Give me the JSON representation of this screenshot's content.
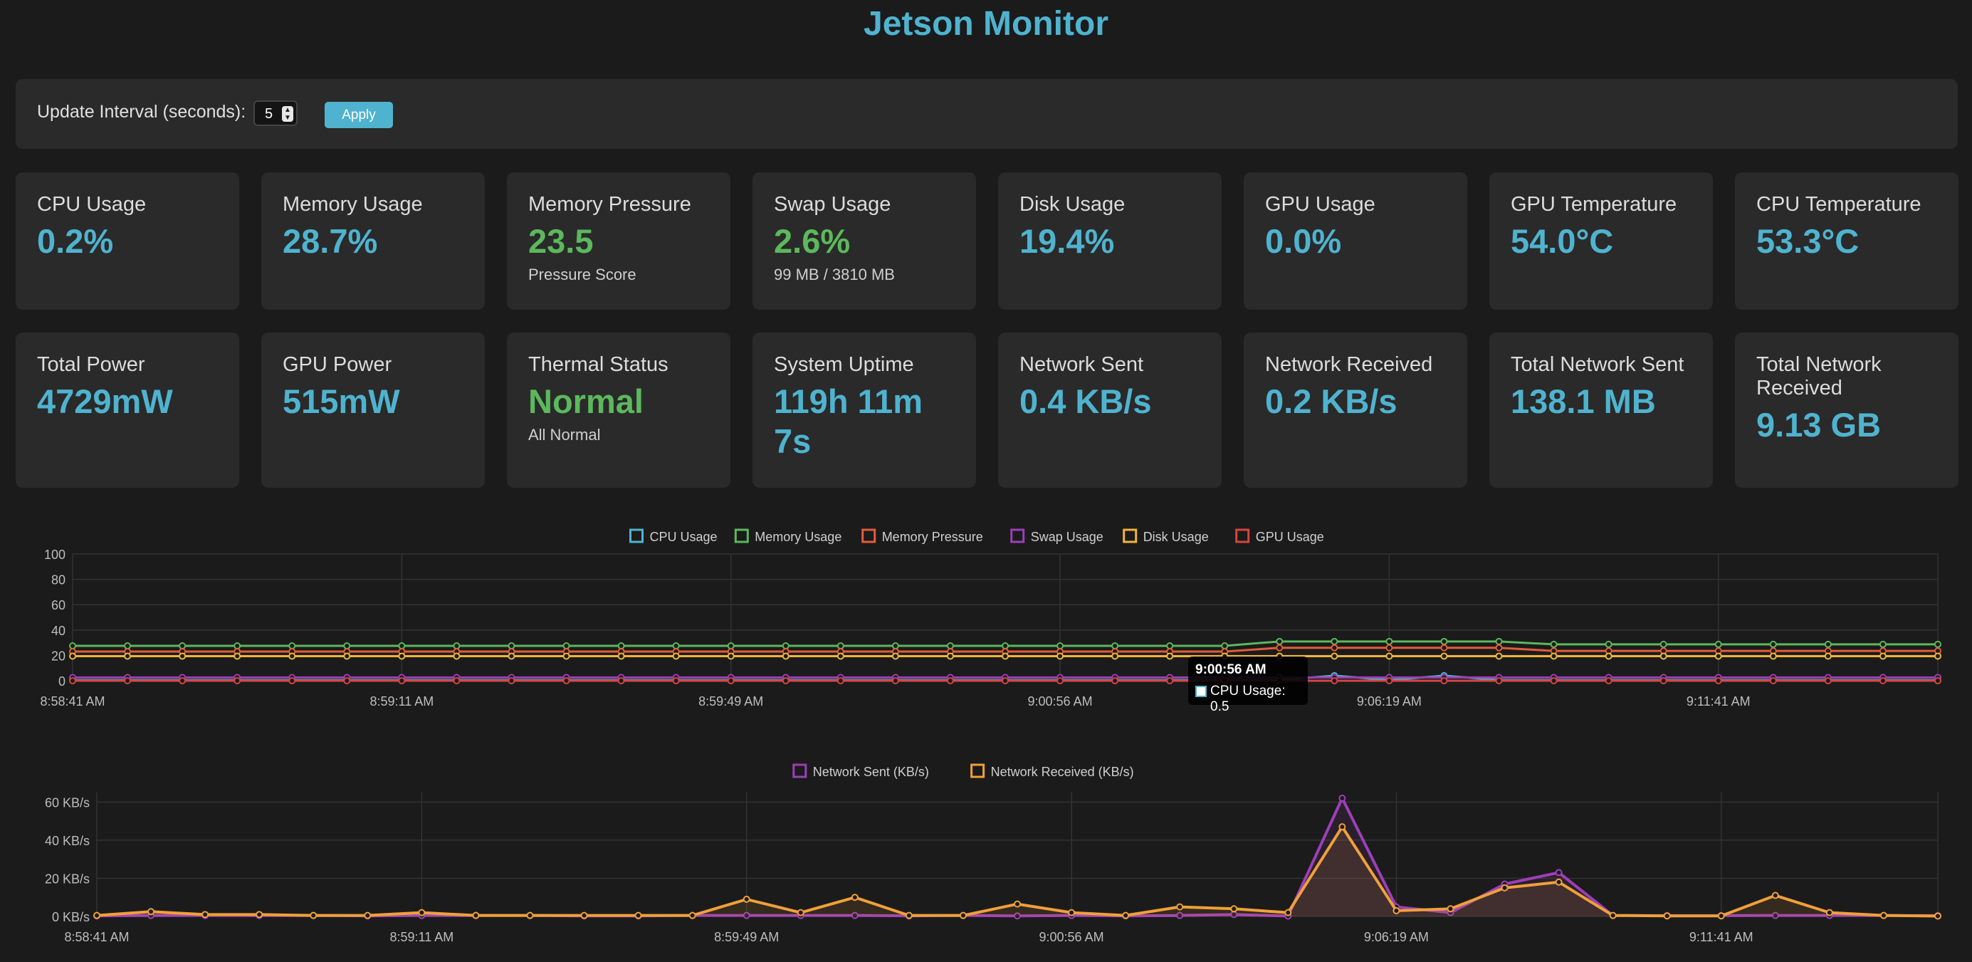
{
  "app": {
    "title": "Jetson Monitor"
  },
  "controls": {
    "interval_label": "Update Interval (seconds):",
    "interval_value": "5",
    "apply_label": "Apply"
  },
  "cards_row1": [
    {
      "title": "CPU Usage",
      "value": "0.2%",
      "sub": "",
      "color": "blue"
    },
    {
      "title": "Memory Usage",
      "value": "28.7%",
      "sub": "",
      "color": "blue"
    },
    {
      "title": "Memory Pressure",
      "value": "23.5",
      "sub": "Pressure Score",
      "color": "green"
    },
    {
      "title": "Swap Usage",
      "value": "2.6%",
      "sub": "99 MB / 3810 MB",
      "color": "green"
    },
    {
      "title": "Disk Usage",
      "value": "19.4%",
      "sub": "",
      "color": "blue"
    },
    {
      "title": "GPU Usage",
      "value": "0.0%",
      "sub": "",
      "color": "blue"
    },
    {
      "title": "GPU Temperature",
      "value": "54.0°C",
      "sub": "",
      "color": "blue"
    },
    {
      "title": "CPU Temperature",
      "value": "53.3°C",
      "sub": "",
      "color": "blue"
    }
  ],
  "cards_row2": [
    {
      "title": "Total Power",
      "value": "4729mW",
      "sub": "",
      "color": "blue"
    },
    {
      "title": "GPU Power",
      "value": "515mW",
      "sub": "",
      "color": "blue"
    },
    {
      "title": "Thermal Status",
      "value": "Normal",
      "sub": "All Normal",
      "color": "green"
    },
    {
      "title": "System Uptime",
      "value": "119h 11m 7s",
      "sub": "",
      "color": "blue"
    },
    {
      "title": "Network Sent",
      "value": "0.4 KB/s",
      "sub": "",
      "color": "blue"
    },
    {
      "title": "Network Received",
      "value": "0.2 KB/s",
      "sub": "",
      "color": "blue"
    },
    {
      "title": "Total Network Sent",
      "value": "138.1 MB",
      "sub": "",
      "color": "blue"
    },
    {
      "title": "Total Network Received",
      "value": "9.13 GB",
      "sub": "",
      "color": "blue"
    }
  ],
  "colors": {
    "accent": "#4fb3cf",
    "good": "#5cb85c",
    "panel": "#2a2a2a",
    "background": "#1b1b1b"
  },
  "tooltip": {
    "title": "9:00:56 AM",
    "line": "CPU Usage: 0.5"
  },
  "chart_data": [
    {
      "type": "line",
      "x_tick_labels": [
        "8:58:41 AM",
        "8:59:11 AM",
        "8:59:49 AM",
        "9:00:56 AM",
        "9:06:19 AM",
        "9:11:41 AM"
      ],
      "ylim": [
        0,
        100
      ],
      "y_ticks": [
        "0",
        "20",
        "40",
        "60",
        "80",
        "100"
      ],
      "grid": true,
      "legend_position": "top",
      "series": [
        {
          "name": "CPU Usage",
          "color": "#4fb3cf",
          "values": [
            0.5,
            0.5,
            0.5,
            0.5,
            0.5,
            0.5,
            0.5,
            0.5,
            0.5,
            0.5,
            0.5,
            0.5,
            0.5,
            0.5,
            0.5,
            0.5,
            0.5,
            0.5,
            0.5,
            0.5,
            0.5,
            0.5,
            0.5,
            4,
            0.5,
            4,
            0.5,
            0.5,
            0.5,
            0.5,
            0.5,
            0.5,
            0.5,
            0.5,
            0.5
          ]
        },
        {
          "name": "Memory Usage",
          "color": "#5cb85c",
          "values": [
            27.5,
            27.5,
            27.5,
            27.5,
            27.5,
            27.5,
            27.5,
            27.5,
            27.5,
            27.5,
            27.5,
            27.5,
            27.5,
            27.5,
            27.5,
            27.5,
            27.5,
            27.5,
            27.5,
            27.5,
            27.5,
            27.5,
            31,
            31,
            31,
            31,
            31,
            28.7,
            28.7,
            28.7,
            28.7,
            28.7,
            28.7,
            28.7,
            28.7
          ]
        },
        {
          "name": "Memory Pressure",
          "color": "#e45c3a",
          "values": [
            23,
            23,
            23,
            23,
            23,
            23,
            23,
            23,
            23,
            23,
            23,
            23,
            23,
            23,
            23,
            23,
            23,
            23,
            23,
            23,
            23,
            23,
            26,
            26,
            26,
            26,
            26,
            23.5,
            23.5,
            23.5,
            23.5,
            23.5,
            23.5,
            23.5,
            23.5
          ]
        },
        {
          "name": "Swap Usage",
          "color": "#9c3fb8",
          "values": [
            2.6,
            2.6,
            2.6,
            2.6,
            2.6,
            2.6,
            2.6,
            2.6,
            2.6,
            2.6,
            2.6,
            2.6,
            2.6,
            2.6,
            2.6,
            2.6,
            2.6,
            2.6,
            2.6,
            2.6,
            2.6,
            2.6,
            2.6,
            2.6,
            2.6,
            2.6,
            2.6,
            2.6,
            2.6,
            2.6,
            2.6,
            2.6,
            2.6,
            2.6,
            2.6
          ]
        },
        {
          "name": "Disk Usage",
          "color": "#f0b43a",
          "values": [
            19.4,
            19.4,
            19.4,
            19.4,
            19.4,
            19.4,
            19.4,
            19.4,
            19.4,
            19.4,
            19.4,
            19.4,
            19.4,
            19.4,
            19.4,
            19.4,
            19.4,
            19.4,
            19.4,
            19.4,
            19.4,
            19.4,
            19.4,
            19.4,
            19.4,
            19.4,
            19.4,
            19.4,
            19.4,
            19.4,
            19.4,
            19.4,
            19.4,
            19.4,
            19.4
          ]
        },
        {
          "name": "GPU Usage",
          "color": "#d64541",
          "values": [
            0,
            0,
            0,
            0,
            0,
            0,
            0,
            0,
            0,
            0,
            0,
            0,
            0,
            0,
            0,
            0,
            0,
            0,
            0,
            0,
            0,
            0,
            0,
            0,
            0,
            0,
            0,
            0,
            0,
            0,
            0,
            0,
            0,
            0,
            0
          ]
        }
      ]
    },
    {
      "type": "area",
      "x_tick_labels": [
        "8:58:41 AM",
        "8:59:11 AM",
        "8:59:49 AM",
        "9:00:56 AM",
        "9:06:19 AM",
        "9:11:41 AM"
      ],
      "ylim": [
        0,
        65
      ],
      "y_ticks": [
        "0 KB/s",
        "20 KB/s",
        "40 KB/s",
        "60 KB/s"
      ],
      "grid": true,
      "legend_position": "top",
      "series": [
        {
          "name": "Network Sent (KB/s)",
          "color": "#9c3fb8",
          "values": [
            0.3,
            0.5,
            0.5,
            0.5,
            0.5,
            0.3,
            0.5,
            0.5,
            0.5,
            0.3,
            0.3,
            0.5,
            0.5,
            0.5,
            0.5,
            0.3,
            0.5,
            0.3,
            0.5,
            0.3,
            0.5,
            1,
            0.2,
            62,
            5,
            2,
            17,
            23,
            0.5,
            0.4,
            0.4,
            0.5,
            0.5,
            0.5,
            0.4
          ]
        },
        {
          "name": "Network Received (KB/s)",
          "color": "#f0a03a",
          "values": [
            0.5,
            2.5,
            1,
            1,
            0.5,
            0.5,
            2,
            0.5,
            0.5,
            0.5,
            0.5,
            0.5,
            9,
            2,
            10,
            0.5,
            0.5,
            6.5,
            2,
            0.5,
            5,
            4,
            2,
            47,
            3,
            4,
            15,
            18,
            0.5,
            0.3,
            0.3,
            11,
            2,
            0.5,
            0.2
          ]
        }
      ]
    }
  ]
}
